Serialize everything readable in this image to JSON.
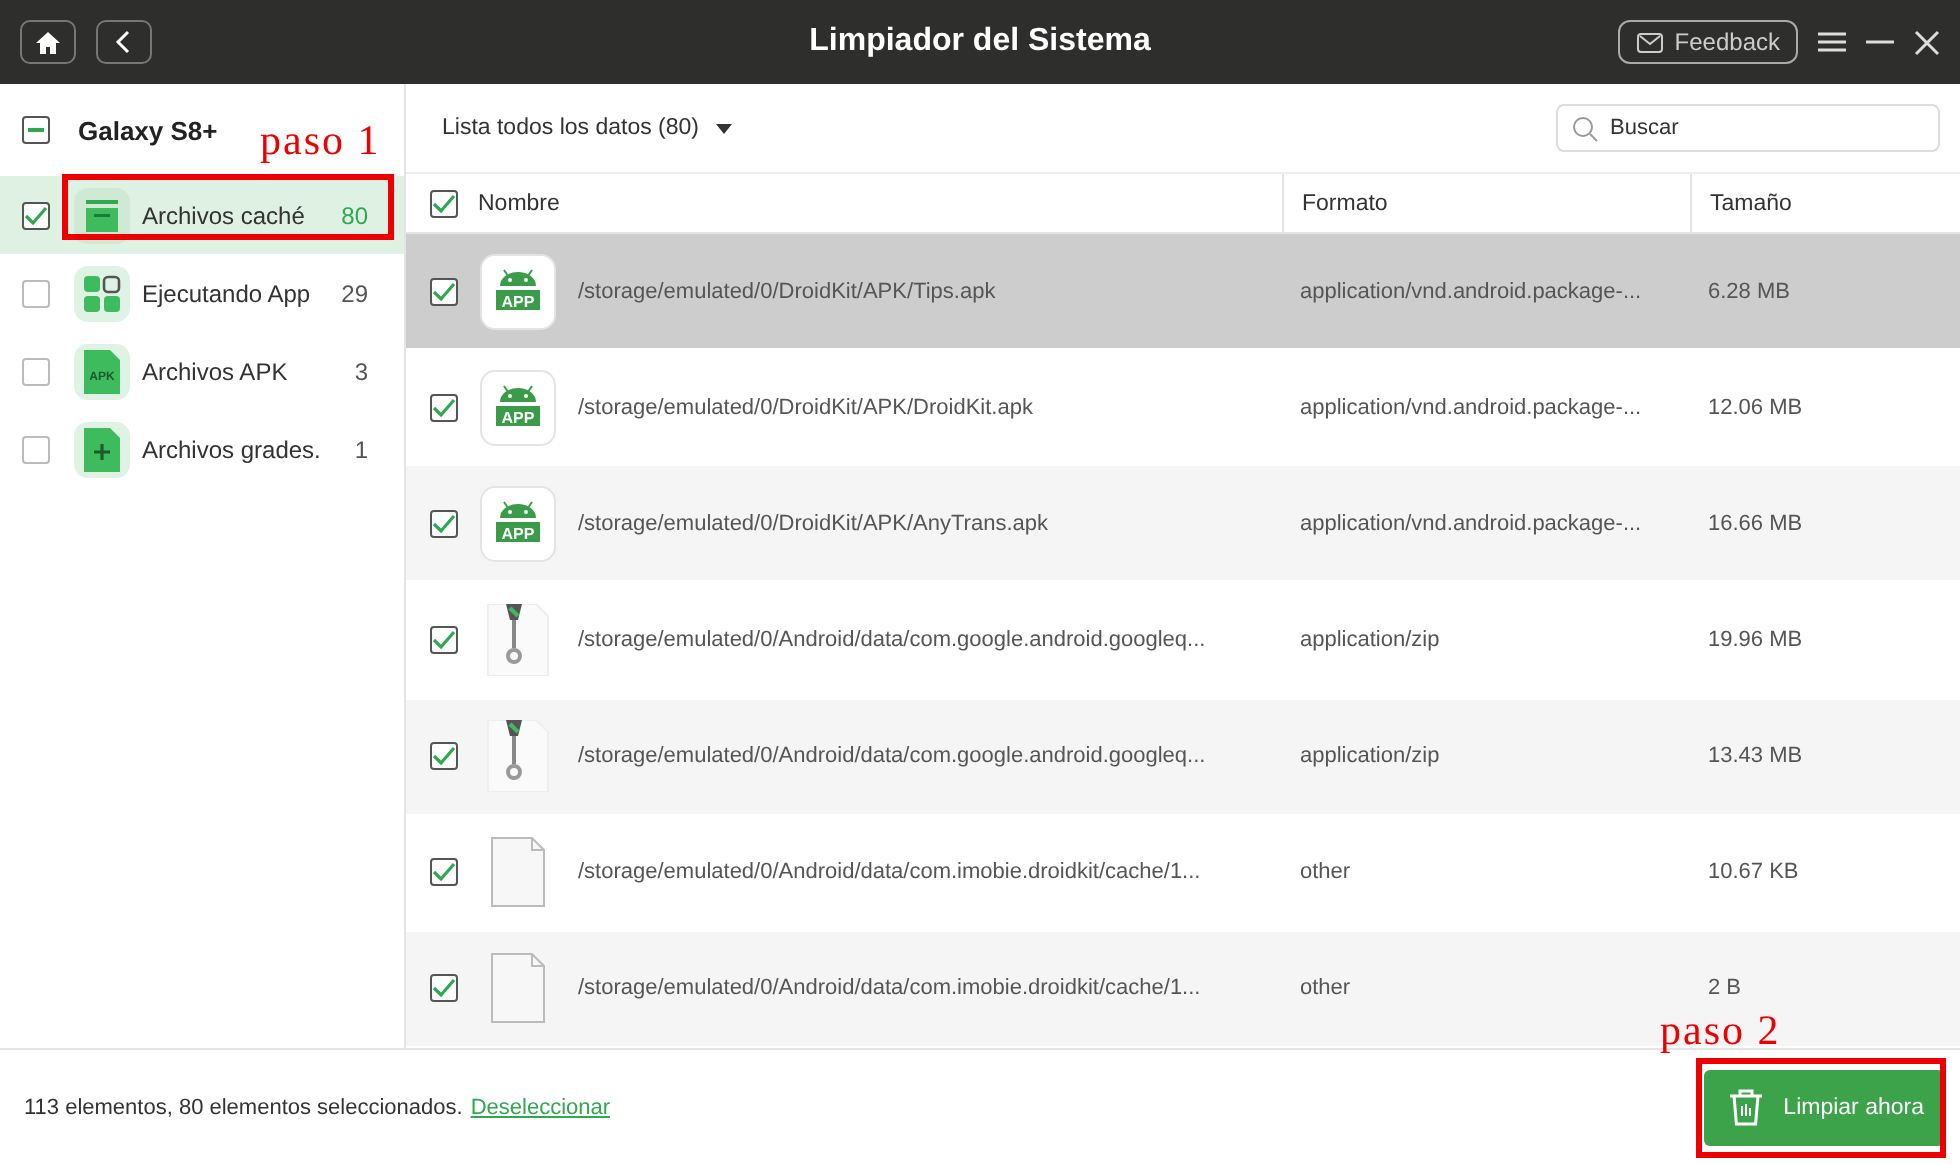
{
  "window": {
    "title": "Limpiador del Sistema",
    "feedback": "Feedback"
  },
  "sidebar": {
    "device": "Galaxy S8+",
    "indeterminate": true,
    "items": [
      {
        "label": "Archivos caché",
        "count": "80",
        "checked": true,
        "selected": true,
        "kind": "cache"
      },
      {
        "label": "Ejecutando App",
        "count": "29",
        "checked": false,
        "selected": false,
        "kind": "apps"
      },
      {
        "label": "Archivos APK",
        "count": "3",
        "checked": false,
        "selected": false,
        "kind": "apk",
        "icon_text": "APK"
      },
      {
        "label": "Archivos grades.",
        "count": "1",
        "checked": false,
        "selected": false,
        "kind": "large"
      }
    ]
  },
  "toolbar": {
    "filter": "Lista todos los datos (80)",
    "search": {
      "placeholder": "Buscar"
    }
  },
  "table": {
    "all_checked": true,
    "columns": [
      "Nombre",
      "Formato",
      "Tamaño"
    ],
    "rows": [
      {
        "kind": "apk",
        "icon_text": "APP",
        "name": "/storage/emulated/0/DroidKit/APK/Tips.apk",
        "format": "application/vnd.android.package-...",
        "size": "6.28 MB",
        "checked": true,
        "selected": true
      },
      {
        "kind": "apk",
        "icon_text": "APP",
        "name": "/storage/emulated/0/DroidKit/APK/DroidKit.apk",
        "format": "application/vnd.android.package-...",
        "size": "12.06 MB",
        "checked": true,
        "selected": false
      },
      {
        "kind": "apk",
        "icon_text": "APP",
        "name": "/storage/emulated/0/DroidKit/APK/AnyTrans.apk",
        "format": "application/vnd.android.package-...",
        "size": "16.66 MB",
        "checked": true,
        "selected": false
      },
      {
        "kind": "zip",
        "name": "/storage/emulated/0/Android/data/com.google.android.googleq...",
        "format": "application/zip",
        "size": "19.96 MB",
        "checked": true,
        "selected": false
      },
      {
        "kind": "zip",
        "name": "/storage/emulated/0/Android/data/com.google.android.googleq...",
        "format": "application/zip",
        "size": "13.43 MB",
        "checked": true,
        "selected": false
      },
      {
        "kind": "file",
        "name": "/storage/emulated/0/Android/data/com.imobie.droidkit/cache/1...",
        "format": "other",
        "size": "10.67 KB",
        "checked": true,
        "selected": false
      },
      {
        "kind": "file",
        "name": "/storage/emulated/0/Android/data/com.imobie.droidkit/cache/1...",
        "format": "other",
        "size": "2 B",
        "checked": true,
        "selected": false
      }
    ]
  },
  "footer": {
    "status": "113 elementos, 80 elementos seleccionados.",
    "link": "Deseleccionar",
    "button": "Limpiar ahora"
  },
  "annotations": [
    {
      "text": "paso 1"
    },
    {
      "text": "paso 2"
    }
  ]
}
